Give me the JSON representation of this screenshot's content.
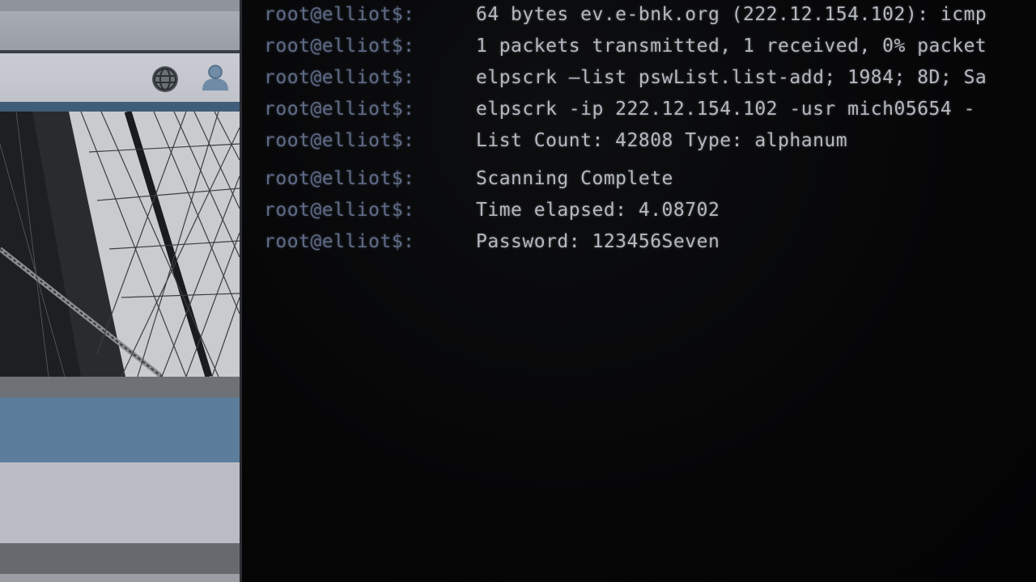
{
  "terminal": {
    "lines": [
      {
        "prompt": "root@elliot$:",
        "text": "64 bytes ev.e-bnk.org (222.12.154.102): icmp"
      },
      {
        "prompt": "root@elliot$:",
        "text": "1 packets transmitted, 1 received, 0% packet"
      },
      {
        "prompt": "root@elliot$:",
        "text": "elpscrk –list pswList.list-add; 1984; 8D; Sa"
      },
      {
        "prompt": "root@elliot$:",
        "text": "elpscrk  -ip 222.12.154.102 -usr mich05654 -"
      },
      {
        "prompt": "root@elliot$:",
        "text": "List Count: 42808 Type: alphanum"
      },
      {
        "prompt": "root@elliot$:",
        "text": "Scanning Complete"
      },
      {
        "prompt": "root@elliot$:",
        "text": "Time elapsed: 4.08702"
      },
      {
        "prompt": "root@elliot$:",
        "text": "Password: 123456Seven"
      }
    ]
  },
  "browser_panel": {
    "icons": [
      "globe-icon",
      "user-icon"
    ]
  },
  "colors": {
    "prompt": "#5f6b86",
    "command_text": "#b4b8bf",
    "terminal_bg": "#050506",
    "panel_blue": "#5c7e9c"
  }
}
